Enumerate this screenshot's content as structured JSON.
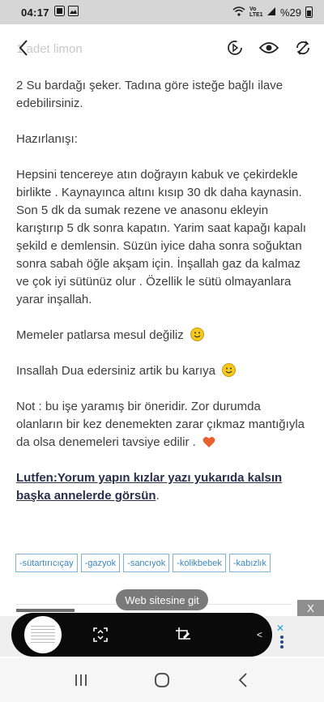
{
  "status_bar": {
    "time": "04:17",
    "battery_text": "%29",
    "network_label": "Vo LTE1"
  },
  "app_bar": {
    "title": "1 adet limon",
    "back_icon": "chevron-left-icon",
    "actions": [
      "reader-mode-icon",
      "eye-icon",
      "sync-icon"
    ]
  },
  "article": {
    "line_sugar": "2 Su bardağı şeker.  Tadına göre isteğe bağlı ilave edebilirsiniz.",
    "heading_preparation": "Hazırlanışı:",
    "preparation": "Hepsini tencereye atın doğrayın kabuk ve çekirdekle birlikte . Kaynayınca altını kısıp 30 dk daha kaynasin. Son 5 dk da sumak rezene ve anasonu ekleyin karıştırıp 5 dk sonra kapatın.  Yarim saat kapağı kapalı şekild e demlensin.  Süzün iyice daha sonra soğuktan sonra sabah öğle akşam için.  İnşallah gaz da kalmaz ve çok iyi sütünüz olur . Özellik le sütü olmayanlara yarar inşallah.",
    "memeler": "Memeler patlarsa mesul değiliz",
    "dua": "Insallah Dua edersiniz artik bu karıya",
    "note": "Not : bu işe yaramış bir öneridir.  Zor durumda olanların bir kez denemekten zarar çıkmaz mantığıyla da olsa denemeleri tavsiye edilir .",
    "call_to_action": "Lutfen:Yorum yapın kızlar yazı yukarıda kalsın başka annelerde görsün",
    "call_to_action_end": "."
  },
  "tags": [
    "-sütartırıcıçay",
    "-gazyok",
    "-sancıyok",
    "-kolikbebek",
    "-kabızlık"
  ],
  "overlay": {
    "web_chip": "Web sitesine git",
    "close_label": "X",
    "ad_close": "✕"
  },
  "colors": {
    "tag_border": "#7fb3d5",
    "tag_text": "#3a86c6",
    "cta_text": "#2a2f4a",
    "heart": "#e8612c",
    "smiley": "#f2c91c"
  }
}
